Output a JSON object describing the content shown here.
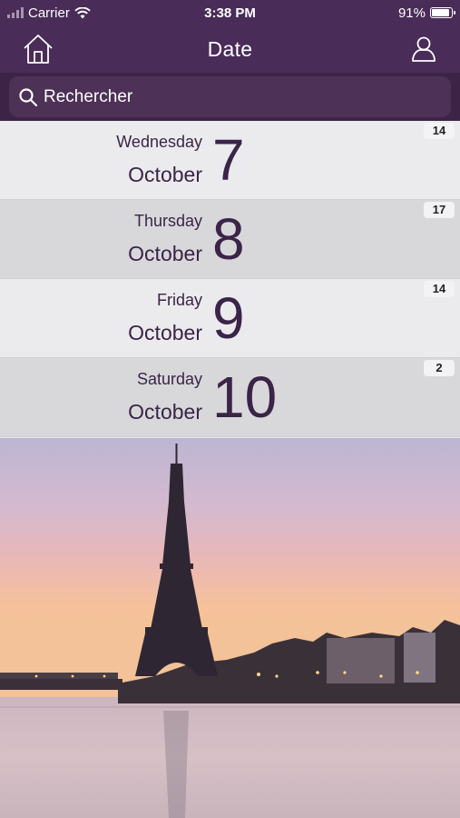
{
  "status_bar": {
    "carrier": "Carrier",
    "time": "3:38 PM",
    "battery": "91%",
    "battery_level": 0.91
  },
  "header": {
    "title": "Date",
    "home_icon": "home-icon",
    "user_icon": "user-icon"
  },
  "search": {
    "placeholder": "Rechercher"
  },
  "dates": [
    {
      "weekday": "Wednesday",
      "month": "October",
      "day": "7",
      "count": "14"
    },
    {
      "weekday": "Thursday",
      "month": "October",
      "day": "8",
      "count": "17"
    },
    {
      "weekday": "Friday",
      "month": "October",
      "day": "9",
      "count": "14"
    },
    {
      "weekday": "Saturday",
      "month": "October",
      "day": "10",
      "count": "2"
    }
  ],
  "colors": {
    "primary": "#4a2c58",
    "text": "#3a2447"
  }
}
